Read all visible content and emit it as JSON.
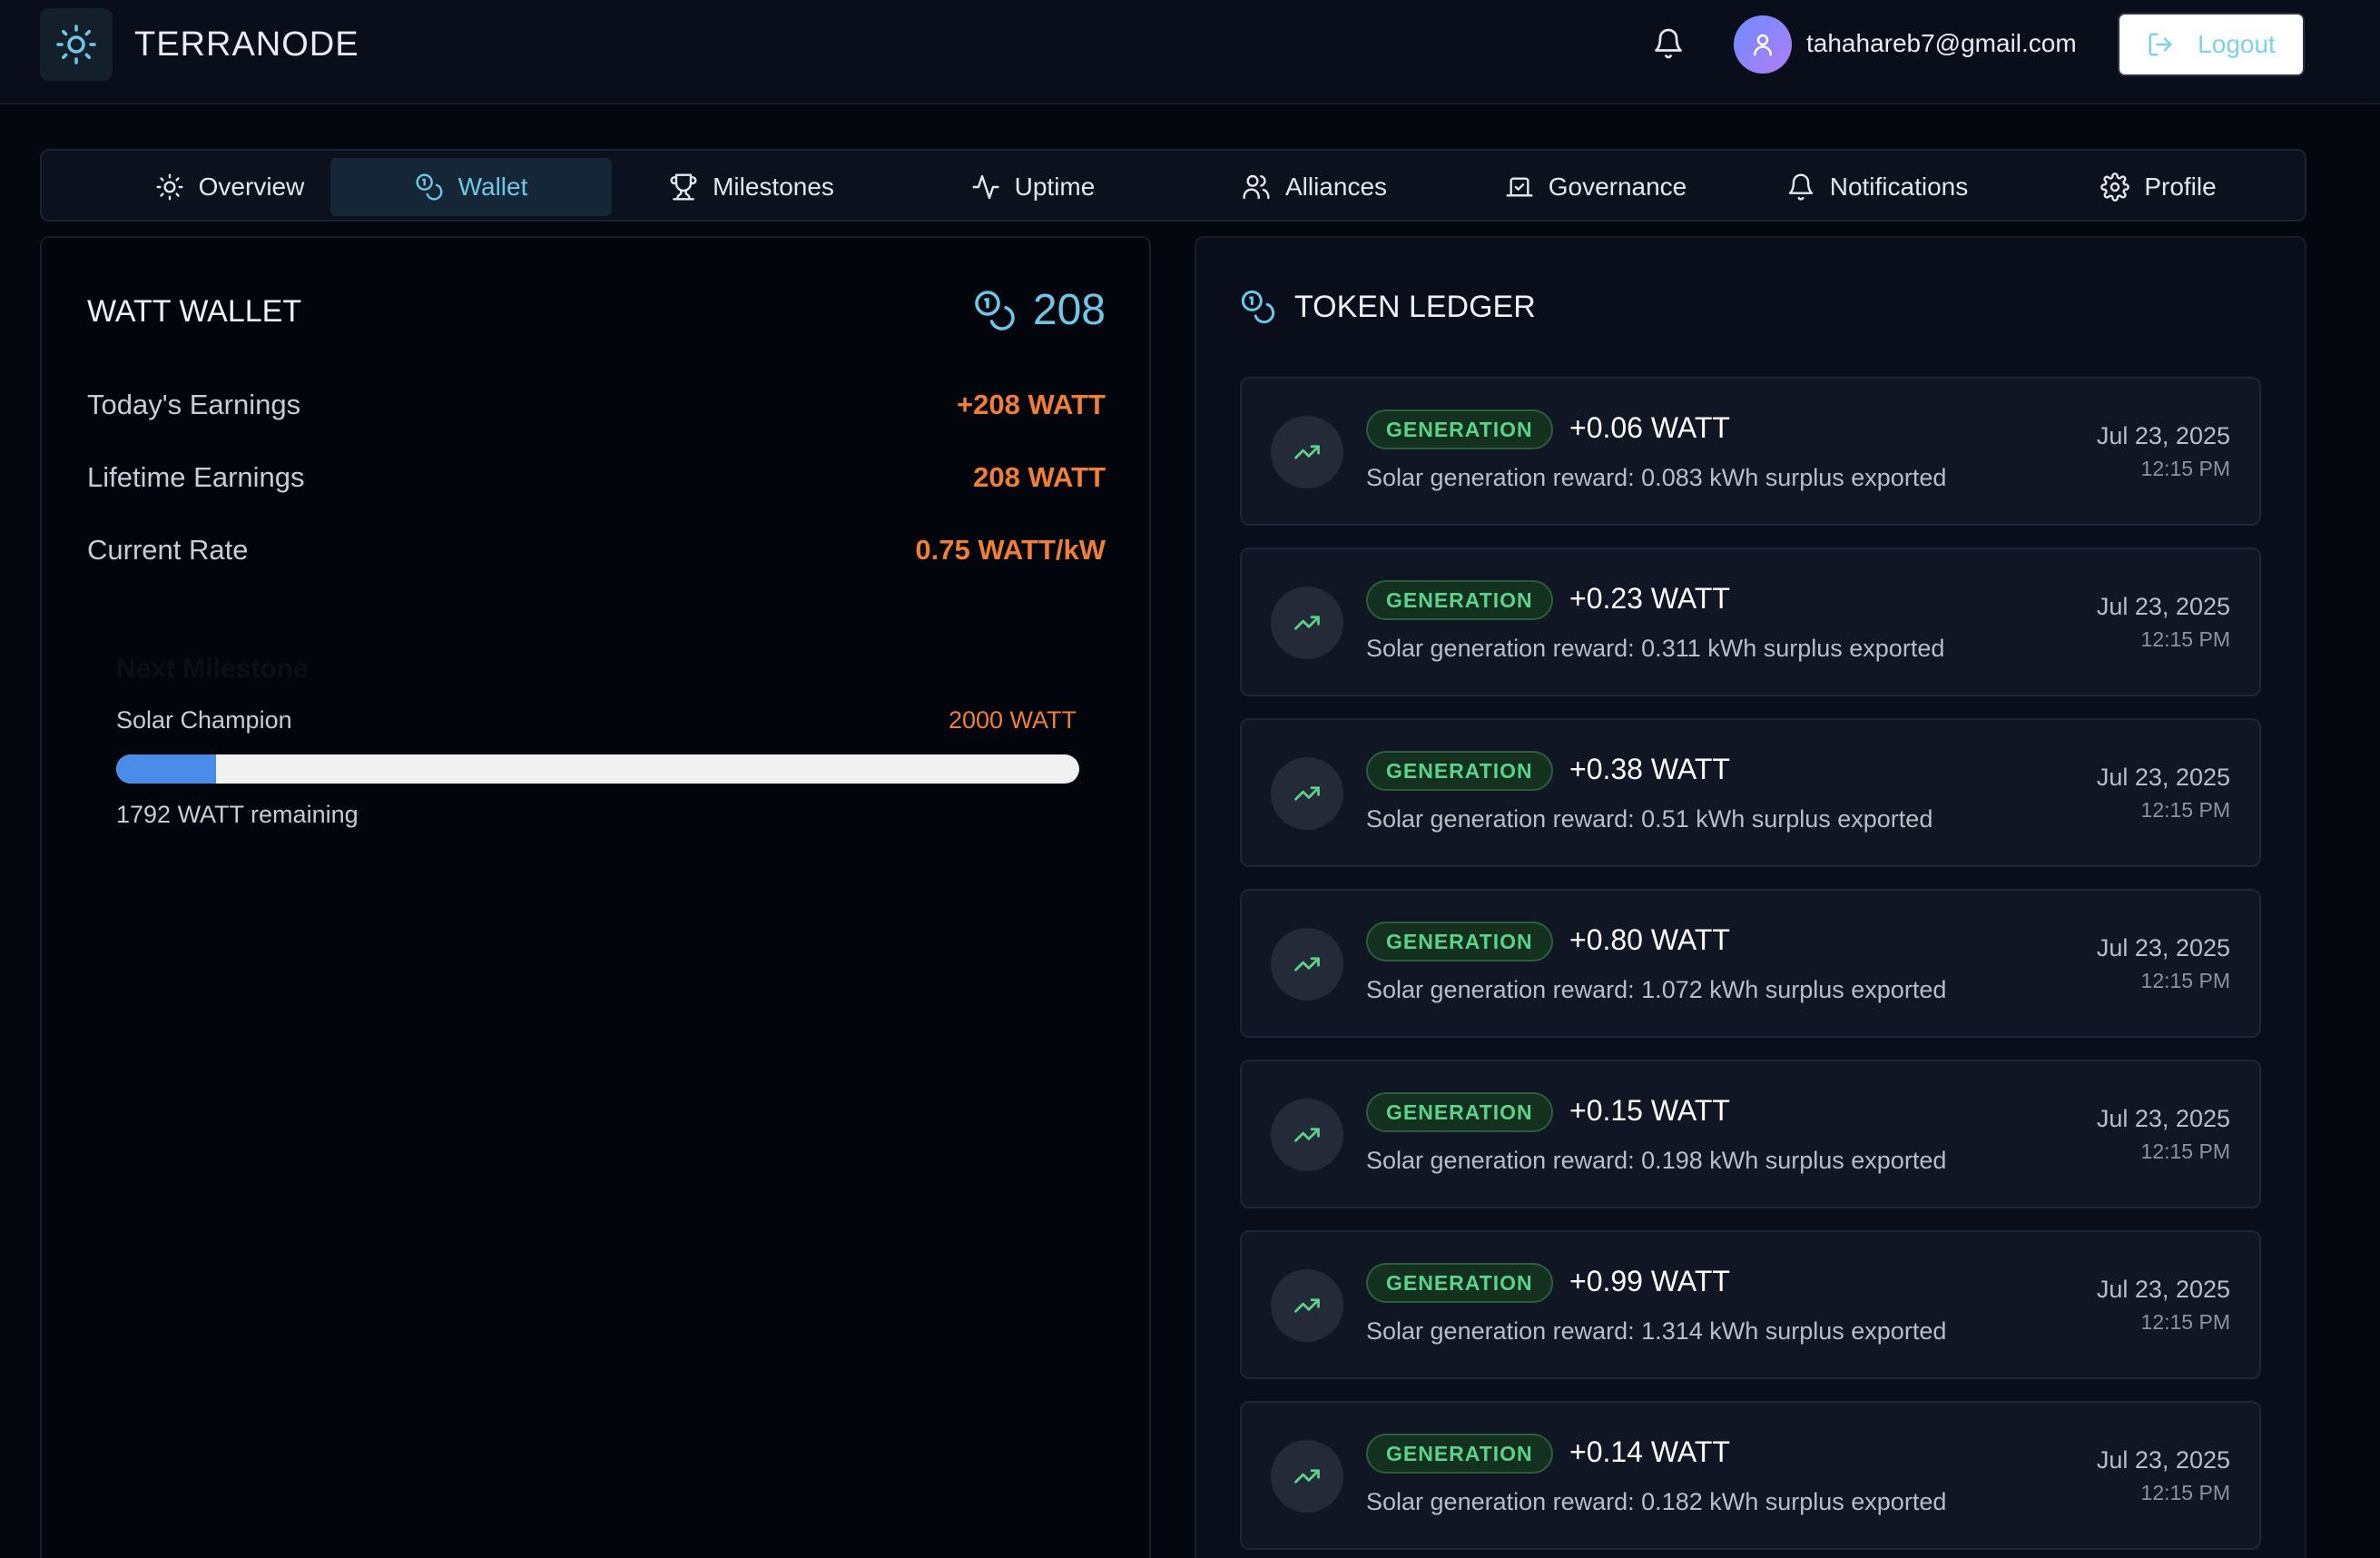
{
  "header": {
    "brand": "TERRANODE",
    "email": "tahahareb7@gmail.com",
    "logout_label": "Logout",
    "icons": [
      "sun-icon",
      "bell-icon",
      "user-icon",
      "logout-icon"
    ]
  },
  "tabs": [
    {
      "label": "Overview",
      "icon": "sun-icon",
      "active": false
    },
    {
      "label": "Wallet",
      "icon": "coins-icon",
      "active": true
    },
    {
      "label": "Milestones",
      "icon": "trophy-icon",
      "active": false
    },
    {
      "label": "Uptime",
      "icon": "activity-icon",
      "active": false
    },
    {
      "label": "Alliances",
      "icon": "users-icon",
      "active": false
    },
    {
      "label": "Governance",
      "icon": "vote-icon",
      "active": false
    },
    {
      "label": "Notifications",
      "icon": "bell-icon",
      "active": false
    },
    {
      "label": "Profile",
      "icon": "gear-icon",
      "active": false
    }
  ],
  "wallet": {
    "title": "WATT WALLET",
    "balance": "208",
    "stats": [
      {
        "label": "Today's Earnings",
        "value": "+208 WATT"
      },
      {
        "label": "Lifetime Earnings",
        "value": "208 WATT"
      },
      {
        "label": "Current Rate",
        "value": "0.75 WATT/kW"
      }
    ],
    "milestone": {
      "heading": "Next Milestone",
      "name": "Solar Champion",
      "target": "2000 WATT",
      "remaining": "1792 WATT remaining",
      "progress_fraction": 0.104
    }
  },
  "ledger": {
    "title": "TOKEN LEDGER",
    "entries": [
      {
        "type": "GENERATION",
        "amount": "+0.06 WATT",
        "desc": "Solar generation reward: 0.083 kWh surplus exported",
        "date": "Jul 23, 2025",
        "time": "12:15 PM"
      },
      {
        "type": "GENERATION",
        "amount": "+0.23 WATT",
        "desc": "Solar generation reward: 0.311 kWh surplus exported",
        "date": "Jul 23, 2025",
        "time": "12:15 PM"
      },
      {
        "type": "GENERATION",
        "amount": "+0.38 WATT",
        "desc": "Solar generation reward: 0.51 kWh surplus exported",
        "date": "Jul 23, 2025",
        "time": "12:15 PM"
      },
      {
        "type": "GENERATION",
        "amount": "+0.80 WATT",
        "desc": "Solar generation reward: 1.072 kWh surplus exported",
        "date": "Jul 23, 2025",
        "time": "12:15 PM"
      },
      {
        "type": "GENERATION",
        "amount": "+0.15 WATT",
        "desc": "Solar generation reward: 0.198 kWh surplus exported",
        "date": "Jul 23, 2025",
        "time": "12:15 PM"
      },
      {
        "type": "GENERATION",
        "amount": "+0.99 WATT",
        "desc": "Solar generation reward: 1.314 kWh surplus exported",
        "date": "Jul 23, 2025",
        "time": "12:15 PM"
      },
      {
        "type": "GENERATION",
        "amount": "+0.14 WATT",
        "desc": "Solar generation reward: 0.182 kWh surplus exported",
        "date": "Jul 23, 2025",
        "time": "12:15 PM"
      }
    ]
  },
  "colors": {
    "accent": "#6fc6e5",
    "earnings": "#ee7f37",
    "badge": "#5cd38a",
    "progress": "#4a8de8"
  }
}
